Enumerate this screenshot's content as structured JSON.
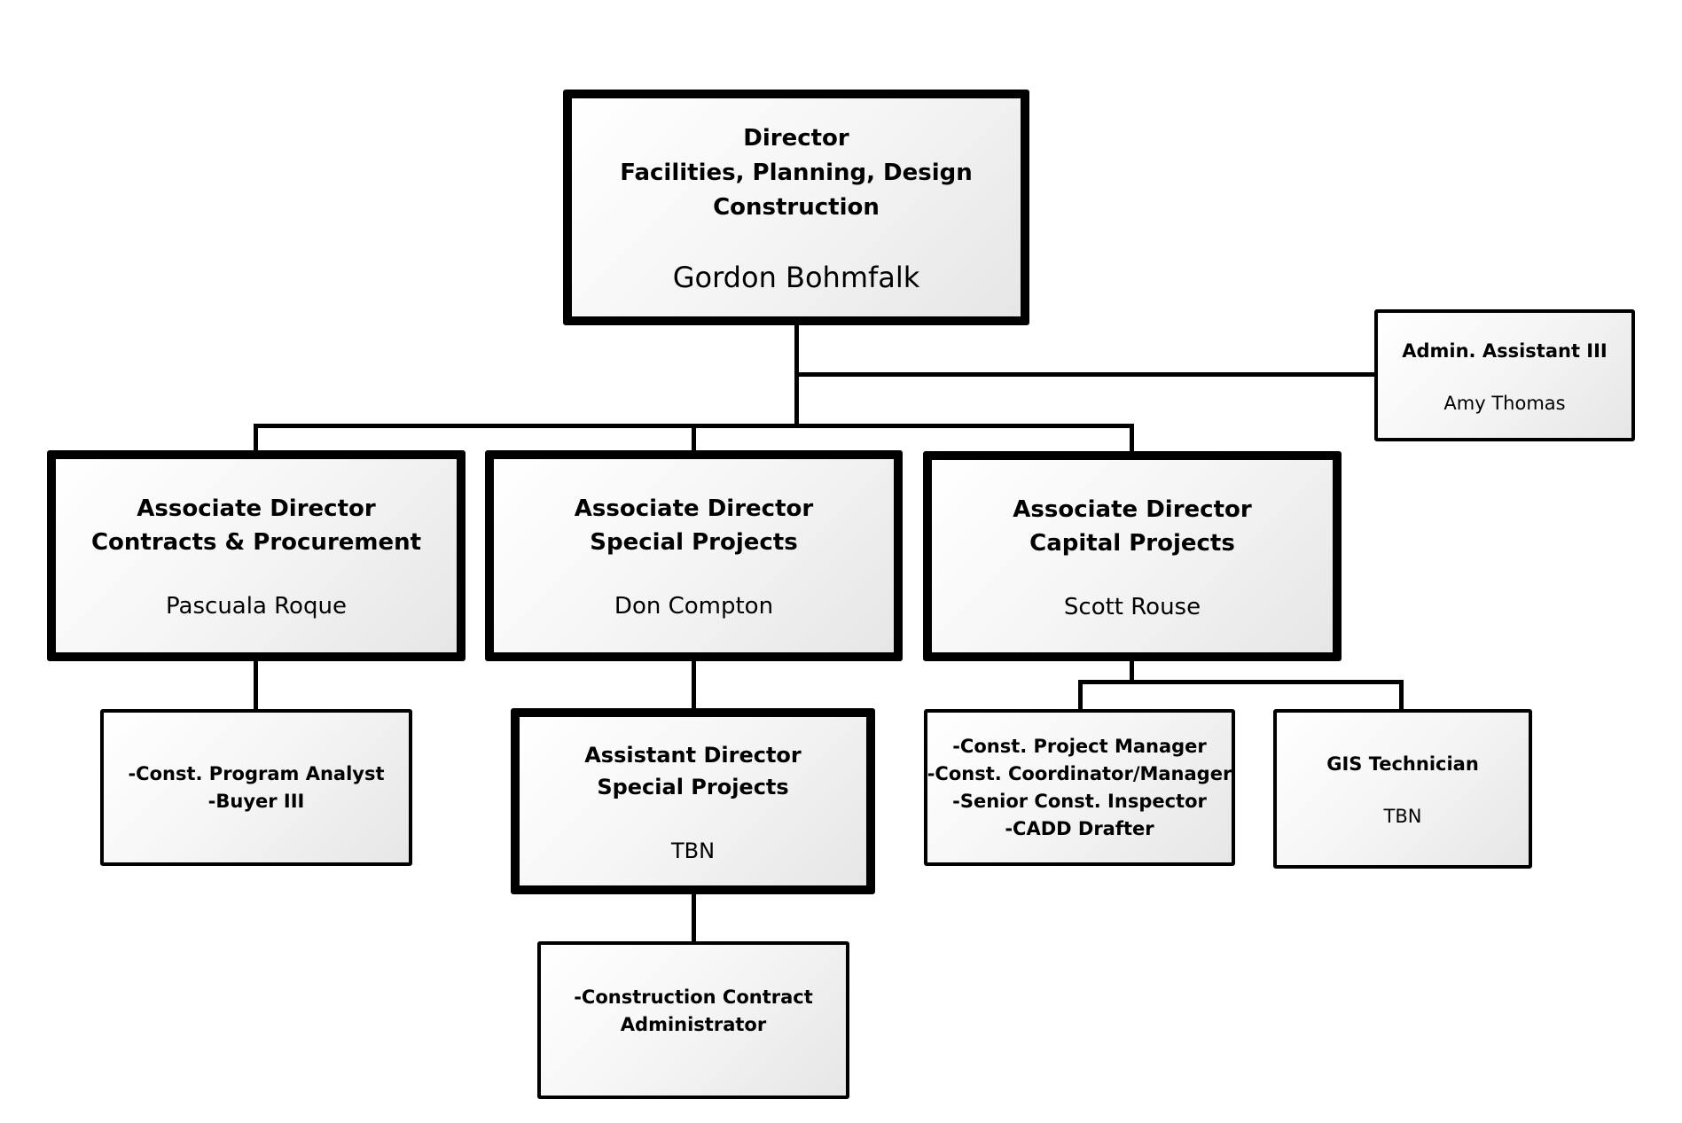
{
  "diagram_type": "organizational chart",
  "colors": {
    "border": "#000000",
    "box_fill_light": "#ffffff",
    "box_fill_dark": "#e6e6e6",
    "background": "#ffffff"
  },
  "director": {
    "title_lines": [
      "Director",
      "Facilities, Planning, Design",
      "Construction"
    ],
    "name": "Gordon Bohmfalk"
  },
  "admin_assistant": {
    "title_lines": [
      "Admin. Assistant III"
    ],
    "name": "Amy Thomas"
  },
  "associate_directors": [
    {
      "title_lines": [
        "Associate Director",
        "Contracts & Procurement"
      ],
      "name": "Pascuala Roque"
    },
    {
      "title_lines": [
        "Associate Director",
        "Special Projects"
      ],
      "name": "Don Compton"
    },
    {
      "title_lines": [
        "Associate Director",
        "Capital Projects"
      ],
      "name": "Scott Rouse"
    }
  ],
  "contracts_staff": {
    "lines": [
      "-Const. Program Analyst",
      "-Buyer III"
    ]
  },
  "assistant_director": {
    "title_lines": [
      "Assistant Director",
      "Special Projects"
    ],
    "name": "TBN"
  },
  "contract_admin_staff": {
    "lines": [
      "-Construction Contract",
      "Administrator"
    ]
  },
  "capital_staff": {
    "lines": [
      "-Const. Project Manager",
      "-Const. Coordinator/Manager",
      "-Senior Const. Inspector",
      "-CADD Drafter"
    ]
  },
  "gis": {
    "title_lines": [
      "GIS Technician"
    ],
    "name": "TBN"
  }
}
